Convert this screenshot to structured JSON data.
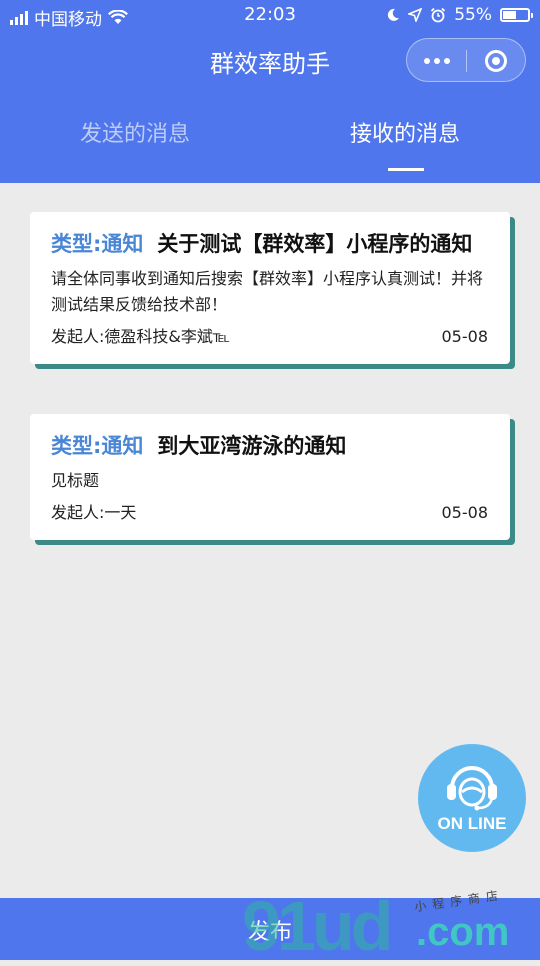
{
  "status_bar": {
    "carrier": "中国移动",
    "time": "22:03",
    "battery_percent": "55%",
    "battery_level": 0.55,
    "icons": [
      "signal-icon",
      "wifi-icon",
      "moon-icon",
      "location-icon",
      "alarm-icon",
      "battery-icon"
    ]
  },
  "nav": {
    "title": "群效率助手"
  },
  "tabs": [
    {
      "label": "发送的消息",
      "active": false
    },
    {
      "label": "接收的消息",
      "active": true
    }
  ],
  "messages": [
    {
      "type": "类型:通知",
      "title": "关于测试【群效率】小程序的通知",
      "body": "请全体同事收到通知后搜索【群效率】小程序认真测试！并将测试结果反馈给技术部！",
      "sender": "发起人:德盈科技&李斌℡",
      "date": "05-08"
    },
    {
      "type": "类型:通知",
      "title": "到大亚湾游泳的通知",
      "body": "见标题",
      "sender": "发起人:一天",
      "date": "05-08"
    }
  ],
  "fab": {
    "label": "ON LINE",
    "icon": "headset-support-icon"
  },
  "bottom_bar": {
    "publish_label": "发布"
  },
  "watermark": {
    "text": "91ud",
    "domain": ".com",
    "subtitle": "小程序商店"
  },
  "colors": {
    "primary": "#4f76ec",
    "type_label": "#4a86d6",
    "card_shadow": "#3b8a88",
    "fab": "#62b9f0"
  }
}
